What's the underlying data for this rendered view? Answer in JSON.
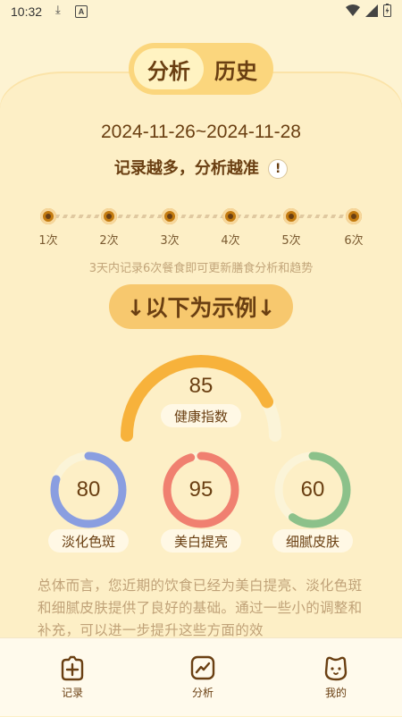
{
  "status_bar": {
    "time": "10:32"
  },
  "top_tabs": {
    "analysis": "分析",
    "history": "历史"
  },
  "date_range": "2024-11-26~2024-11-28",
  "slogan": "记录越多，分析越准",
  "info_icon_glyph": "!",
  "progress_steps": [
    "1次",
    "2次",
    "3次",
    "4次",
    "5次",
    "6次"
  ],
  "hint": "3天内记录6次餐食即可更新膳食分析和趋势",
  "example_banner": "↓以下为示例↓",
  "health": {
    "score": "85",
    "label": "健康指数",
    "fraction": 0.85,
    "color": "#f7b23b"
  },
  "metrics": [
    {
      "value": "80",
      "label": "淡化色斑",
      "fraction": 0.8,
      "color": "#8a9ee0"
    },
    {
      "value": "95",
      "label": "美白提亮",
      "fraction": 0.95,
      "color": "#f08070"
    },
    {
      "value": "60",
      "label": "细腻皮肤",
      "fraction": 0.6,
      "color": "#8cc18a"
    }
  ],
  "summary_text": "总体而言，您近期的饮食已经为美白提亮、淡化色斑和细腻皮肤提供了良好的基础。通过一些小的调整和补充，可以进一步提升这些方面的效",
  "bottom_nav": [
    {
      "label": "记录",
      "icon": "add-record-icon"
    },
    {
      "label": "分析",
      "icon": "trend-chart-icon"
    },
    {
      "label": "我的",
      "icon": "bear-face-icon"
    }
  ]
}
